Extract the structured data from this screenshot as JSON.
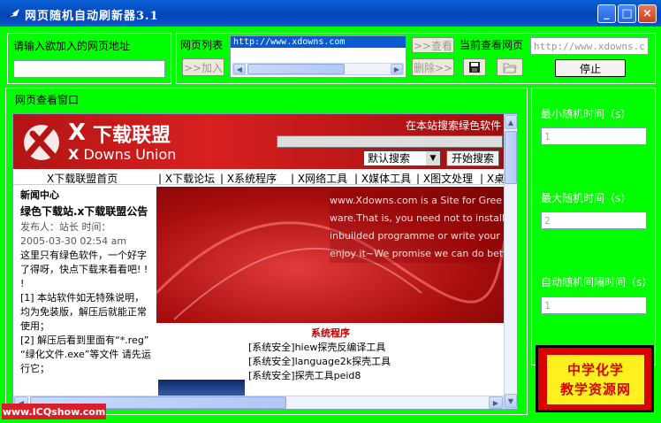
{
  "window": {
    "title": "网页随机自动刷新器3.1",
    "minimize_glyph": "_",
    "maximize_glyph": "□",
    "close_glyph": "×"
  },
  "url_section": {
    "label": "请输入欲加入的网页地址",
    "input_value": ""
  },
  "list_section": {
    "label": "网页列表",
    "items": [
      "http://www.xdowns.com"
    ],
    "add_button": ">>加入",
    "view_button": ">>查看",
    "delete_button": "删除>>",
    "current_label": "当前查看网页",
    "current_value": "http://www.xdowns.com",
    "stop_button": "停止"
  },
  "viewer": {
    "label": "网页查看窗口"
  },
  "website": {
    "search_label": "在本站搜索绿色软件",
    "search_select": "默认搜索",
    "search_button": "开始搜索",
    "brand_cn": "下载联盟",
    "brand_x": "X",
    "brand_en": "Downs Union",
    "nav": [
      "X下载联盟首页",
      "X下载论坛",
      "X系统程序",
      "X网络工具",
      "X媒体工具",
      "X图文处理",
      "X桌"
    ],
    "news_heading": "新闻中心",
    "news_title": "绿色下载站.x下载联盟公告",
    "news_meta1": "发布人：站长 时间：",
    "news_meta2": "2005-03-30 02:54 am",
    "news_body1": "这里只有绿色软件，一个好字了得呀，快点下载来看看吧! ! !",
    "news_body2": "[1] 本站软件如无特殊说明，均为免装版，解压后就能正常使用；",
    "news_body3": "[2] 解压后看到里面有“*.reg” “绿化文件.exe”等文件 请先运行它；",
    "banner_lines": [
      "www.Xdowns.com is a Site for Gree",
      "ware.That is, you need not to install",
      "inbuilded programme or  write your",
      "enjoy it~We promise we can do bett"
    ],
    "category_title": "系统程序",
    "category_items": [
      "[系统安全]hiew探壳反编译工具",
      "[系统安全]language2k探壳工具",
      "[系统安全]探壳工具peid8"
    ]
  },
  "settings": {
    "min_label": "最小随机时间（s）",
    "min_value": "1",
    "max_label": "最大随机时间（s）",
    "max_value": "2",
    "interval_label": "自动随机间隔时间（s）",
    "interval_value": "1"
  },
  "branding": {
    "logo_line1": "中学化学",
    "logo_line2": "教学资源网",
    "watermark": "www.ICQshow.com"
  }
}
